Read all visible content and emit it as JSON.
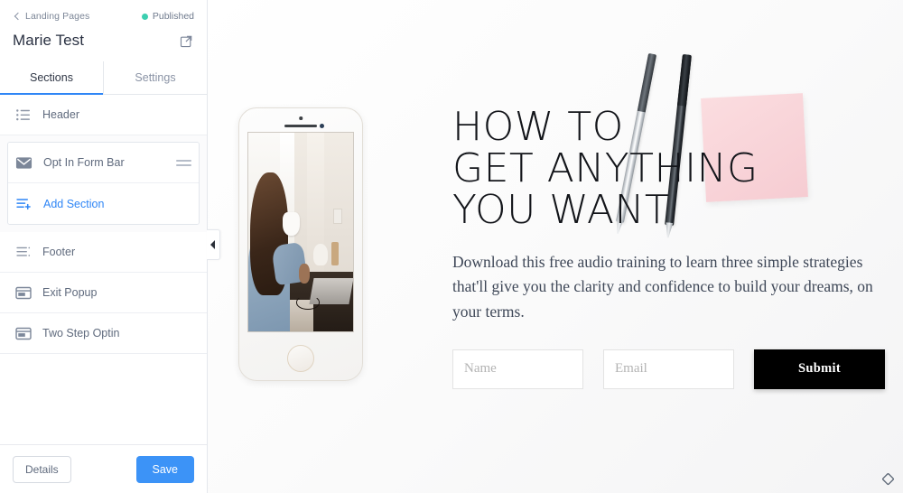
{
  "sidebar": {
    "breadcrumb": {
      "label": "Landing Pages",
      "icon": "chevron-left-icon"
    },
    "status": {
      "label": "Published",
      "color": "#3ccfb0"
    },
    "page_title": "Marie Test",
    "open_external_icon": "external-link-icon",
    "tabs": [
      {
        "label": "Sections",
        "active": true
      },
      {
        "label": "Settings",
        "active": false
      }
    ],
    "sections": [
      {
        "label": "Header",
        "icon": "list-icon",
        "grouped": false,
        "accent": false
      },
      {
        "label": "Opt In Form Bar",
        "icon": "envelope-icon",
        "grouped": true,
        "accent": false,
        "drag_handle": true
      },
      {
        "label": "Add Section",
        "icon": "add-list-icon",
        "grouped": true,
        "accent": true
      },
      {
        "label": "Footer",
        "icon": "footer-list-icon",
        "grouped": false,
        "accent": false
      },
      {
        "label": "Exit Popup",
        "icon": "popup-window-icon",
        "grouped": false,
        "accent": false
      },
      {
        "label": "Two Step Optin",
        "icon": "popup-window-icon",
        "grouped": false,
        "accent": false
      }
    ],
    "footer": {
      "details_label": "Details",
      "save_label": "Save"
    }
  },
  "collapse_tab": {
    "icon": "collapse-left-icon"
  },
  "canvas": {
    "headline": "HOW TO\nGET ANYTHING\nYOU WANT",
    "subcopy": "Download this free audio training to learn three simple strategies that'll give you the clarity and confidence to build your dreams, on your terms.",
    "form": {
      "name_placeholder": "Name",
      "name_value": "",
      "email_placeholder": "Email",
      "email_value": "",
      "submit_label": "Submit"
    },
    "corner_icon": "diamond-handle-icon"
  },
  "colors": {
    "accent_blue": "#2f86f6",
    "save_blue": "#3c93f7",
    "published_teal": "#3ccfb0",
    "submit_black": "#000000",
    "sticky_pink": "#f6ccd2"
  }
}
